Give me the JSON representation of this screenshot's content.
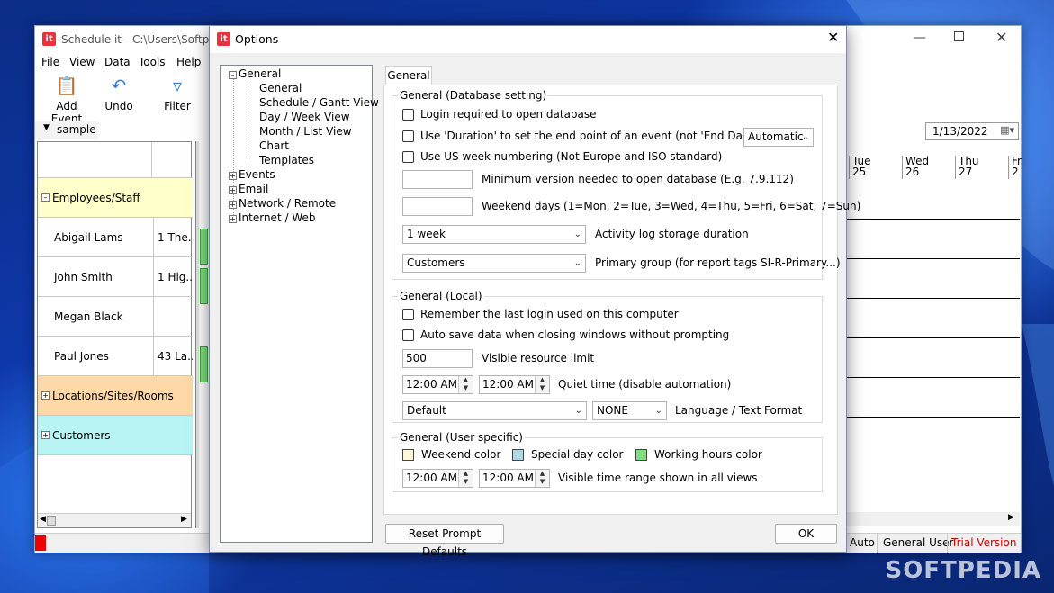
{
  "colors": {
    "accent": "#e8323c",
    "weekend": "#fff8d8",
    "special_day": "#add8e6",
    "working_hours": "#7ee07e",
    "employees_group": "#ffffcc",
    "locations_group": "#ffd8a8",
    "customers_group": "#b8f4f4",
    "trial": "#cc0000"
  },
  "main": {
    "title": "Schedule it - C:\\Users\\Softpedia",
    "app_icon": "it",
    "menu": [
      "File",
      "View",
      "Data",
      "Tools",
      "Help"
    ],
    "toolbar": [
      {
        "label": "Add Event",
        "icon": "add-event-icon"
      },
      {
        "label": "Undo",
        "icon": "undo-icon"
      },
      {
        "label": "Filter",
        "icon": "filter-icon"
      }
    ],
    "view_tab": "sample",
    "date": "1/13/2022",
    "groups": {
      "employees": "Employees/Staff",
      "locations": "Locations/Sites/Rooms",
      "customers": "Customers"
    },
    "resources": [
      {
        "name": "Abigail Lams",
        "addr": "1 The..."
      },
      {
        "name": "John Smith",
        "addr": "1 Hig..."
      },
      {
        "name": "Megan Black",
        "addr": ""
      },
      {
        "name": "Paul Jones",
        "addr": "43 La..."
      }
    ],
    "days": [
      {
        "day": "Tue",
        "num": "25"
      },
      {
        "day": "Wed",
        "num": "26"
      },
      {
        "day": "Thu",
        "num": "27"
      },
      {
        "day": "Fr",
        "num": "2"
      }
    ],
    "status": {
      "auto": "Auto",
      "user": "General User",
      "trial": "Trial Version"
    }
  },
  "dialog": {
    "title": "Options",
    "tree": {
      "root": "General",
      "children": [
        "General",
        "Schedule / Gantt View",
        "Day / Week View",
        "Month / List View",
        "Chart",
        "Templates"
      ],
      "others": [
        "Events",
        "Email",
        "Network / Remote",
        "Internet / Web"
      ]
    },
    "tab": "General",
    "db": {
      "legend": "General (Database setting)",
      "login_required": "Login required to open database",
      "use_duration": "Use 'Duration' to set the end point of an event (not 'End Date/Time')",
      "duration_mode": "Automatic",
      "us_week": "Use US week numbering (Not Europe and ISO standard)",
      "min_version_label": "Minimum version needed to open database (E.g. 7.9.112)",
      "weekend_label": "Weekend days (1=Mon, 2=Tue, 3=Wed, 4=Thu, 5=Fri, 6=Sat, 7=Sun)",
      "log_duration": "1 week",
      "log_duration_label": "Activity log storage duration",
      "primary_group": "Customers",
      "primary_group_label": "Primary group (for report tags SI-R-Primary...)"
    },
    "local": {
      "legend": "General (Local)",
      "remember_login": "Remember the last login used on this computer",
      "auto_save": "Auto save data when closing windows without prompting",
      "visible_limit": "500",
      "visible_limit_label": "Visible resource limit",
      "quiet_from": "12:00 AM",
      "quiet_to": "12:00 AM",
      "quiet_label": "Quiet time (disable automation)",
      "language": "Default",
      "text_format": "NONE",
      "language_label": "Language / Text Format"
    },
    "user": {
      "legend": "General (User specific)",
      "weekend_color": "Weekend color",
      "special_day_color": "Special day color",
      "working_hours_color": "Working hours color",
      "range_from": "12:00 AM",
      "range_to": "12:00 AM",
      "range_label": "Visible time range shown in all views"
    },
    "reset_button": "Reset Prompt Defaults",
    "ok_button": "OK"
  },
  "watermark": "SOFTPEDIA"
}
